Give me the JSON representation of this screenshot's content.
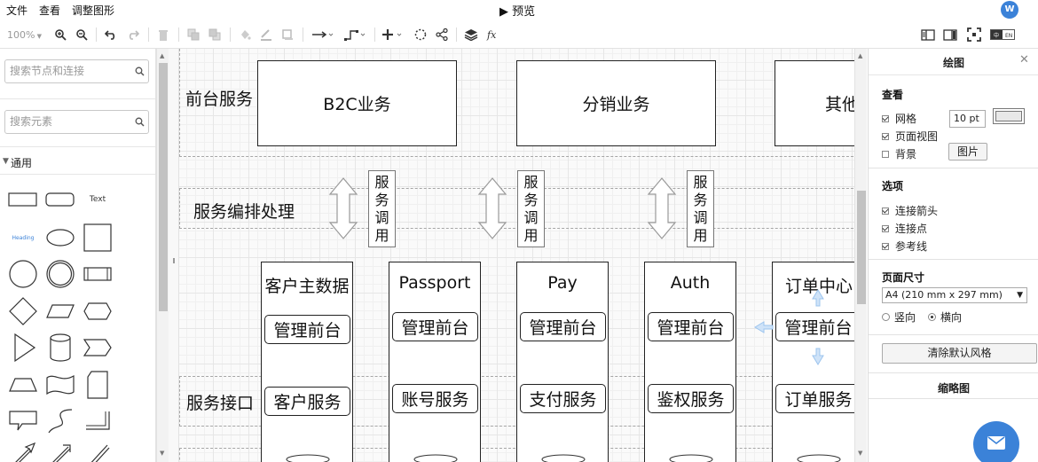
{
  "menu": {
    "items": [
      "文件",
      "查看",
      "调整图形"
    ]
  },
  "title": {
    "icon": "play-icon",
    "text": "预览"
  },
  "user": {
    "avatar_letter": "W"
  },
  "toolbar": {
    "zoom": "100%",
    "icons": [
      "zoom-in-icon",
      "zoom-out-icon",
      "undo-icon",
      "redo-icon",
      "delete-icon",
      "to-front-icon",
      "to-back-icon",
      "fill-color-icon",
      "line-color-icon",
      "shadow-icon",
      "connection-arrow-icon",
      "waypoints-icon",
      "insert-icon",
      "ellipse-select-icon",
      "share-icon",
      "layers-icon",
      "formula-icon",
      "format-panel-icon",
      "outline-toggle-icon",
      "fullscreen-icon",
      "language-toggle-icon"
    ],
    "language_toggle": "EN"
  },
  "sidebar": {
    "search_shapes_placeholder": "搜索节点和连接",
    "search_elements_placeholder": "搜索元素",
    "section_general": "通用",
    "text_shape_label": "Text",
    "heading_shape_label": "Heading",
    "shapes": [
      "rectangle",
      "rounded-rectangle",
      "text",
      "heading-text",
      "ellipse",
      "square",
      "circle",
      "double-circle",
      "process",
      "diamond",
      "parallelogram",
      "hexagon",
      "triangle",
      "cylinder",
      "step",
      "trapezoid",
      "tape",
      "card",
      "callout",
      "curve",
      "partial-rectangle",
      "arrow-diagonal",
      "arrow-double",
      "line"
    ]
  },
  "diagram": {
    "lanes": {
      "frontend": "前台服务",
      "orchestration": "服务编排处理",
      "service_interface": "服务接口"
    },
    "frontend_boxes": [
      "B2C业务",
      "分销业务",
      "其他"
    ],
    "dispatch_label": "服务调用",
    "columns": [
      {
        "title": "客户主数据",
        "admin": "管理前台",
        "service": "客户服务"
      },
      {
        "title": "Passport",
        "admin": "管理前台",
        "service": "账号服务"
      },
      {
        "title": "Pay",
        "admin": "管理前台",
        "service": "支付服务"
      },
      {
        "title": "Auth",
        "admin": "管理前台",
        "service": "鉴权服务"
      },
      {
        "title": "订单中心",
        "admin": "管理前台",
        "service": "订单服务"
      }
    ]
  },
  "format_panel": {
    "title": "绘图",
    "close_icon": "close-icon",
    "view_section": "查看",
    "grid_label": "网格",
    "grid_size": "10 pt",
    "page_view_label": "页面视图",
    "background_label": "背景",
    "image_button": "图片",
    "options_section": "选项",
    "connection_arrows_label": "连接箭头",
    "connection_points_label": "连接点",
    "guides_label": "参考线",
    "page_size_section": "页面尺寸",
    "page_size_value": "A4 (210 mm x 297 mm)",
    "portrait_label": "竖向",
    "landscape_label": "横向",
    "reset_style_button": "清除默认风格",
    "outline_title": "缩略图",
    "grid_checked": true,
    "page_view_checked": true,
    "background_checked": false,
    "connection_arrows_checked": true,
    "connection_points_checked": true,
    "guides_checked": true,
    "orientation": "landscape"
  },
  "fab": {
    "icon": "mail-icon"
  }
}
